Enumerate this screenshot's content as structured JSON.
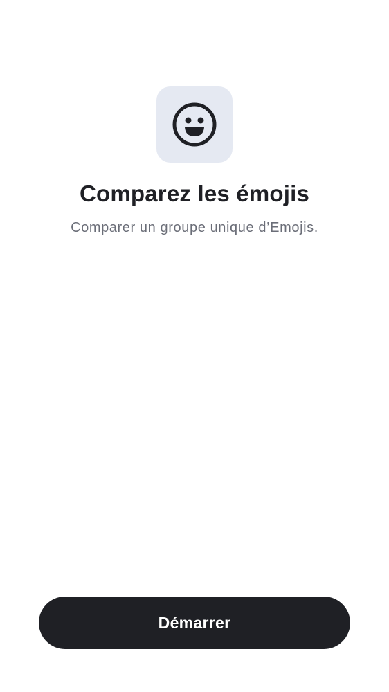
{
  "intro": {
    "icon": "smiley-face-icon",
    "title": "Comparez les émojis",
    "subtitle": "Comparer un groupe unique d’Emojis."
  },
  "actions": {
    "start_label": "Démarrer"
  },
  "colors": {
    "background": "#ffffff",
    "icon_tile": "#e5e9f2",
    "primary_text": "#1f2025",
    "secondary_text": "#6b6e78",
    "button_background": "#1f2025",
    "button_text": "#ffffff"
  }
}
